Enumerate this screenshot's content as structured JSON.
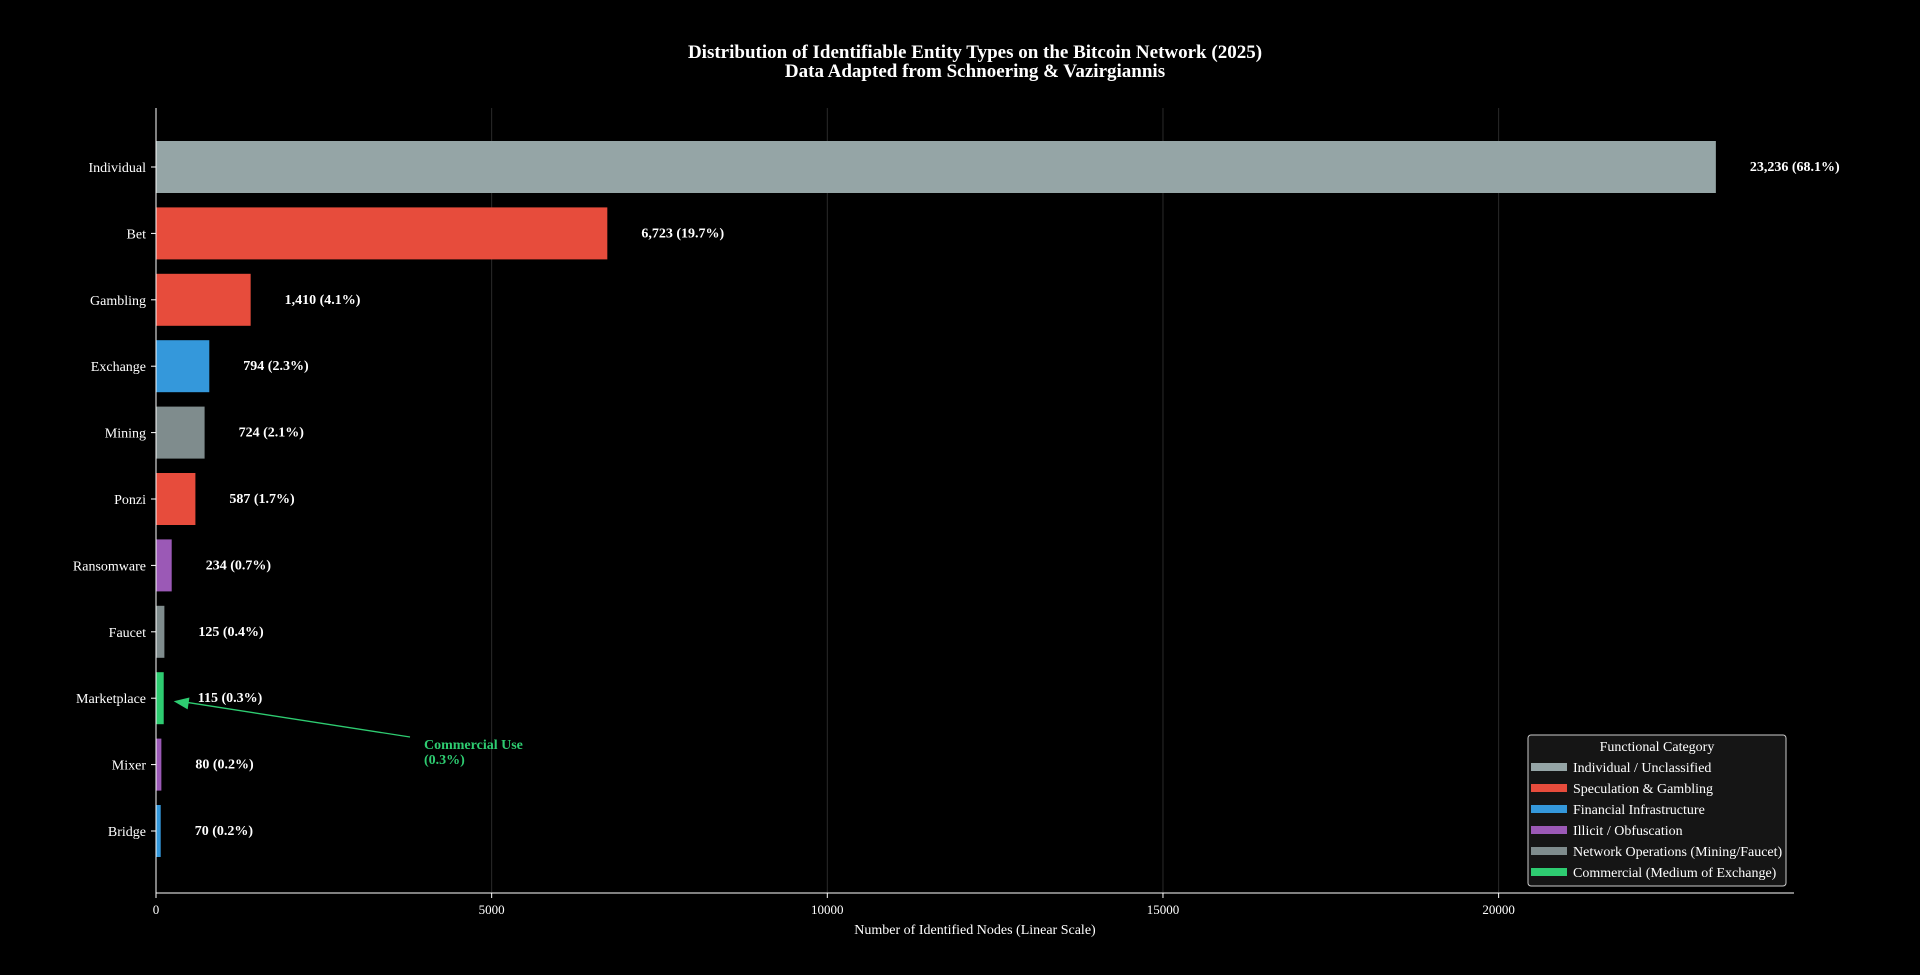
{
  "chart_data": {
    "type": "bar",
    "orientation": "horizontal",
    "title": "Distribution of Identifiable Entity Types on the Bitcoin Network (2025)",
    "subtitle": "Data Adapted from Schnoering & Vazirgiannis",
    "xlabel": "Number of Identified Nodes (Linear Scale)",
    "xlim": [
      0,
      24400
    ],
    "xticks": [
      0,
      5000,
      10000,
      15000,
      20000
    ],
    "grid": true,
    "categories": [
      "Individual",
      "Bet",
      "Gambling",
      "Exchange",
      "Mining",
      "Ponzi",
      "Ransomware",
      "Faucet",
      "Marketplace",
      "Mixer",
      "Bridge"
    ],
    "values": [
      23236,
      6723,
      1410,
      794,
      724,
      587,
      234,
      125,
      115,
      80,
      70
    ],
    "value_labels": [
      "23,236 (68.1%)",
      "6,723 (19.7%)",
      "1,410 (4.1%)",
      "794 (2.3%)",
      "724 (2.1%)",
      "587 (1.7%)",
      "234 (0.7%)",
      "125 (0.4%)",
      "115 (0.3%)",
      "80 (0.2%)",
      "70 (0.2%)"
    ],
    "bar_groups": [
      "individual",
      "speculation",
      "speculation",
      "financial",
      "network",
      "speculation",
      "illicit",
      "network",
      "commercial",
      "illicit",
      "financial"
    ],
    "annotation": {
      "target_category": "Marketplace",
      "lines": [
        "Commercial Use",
        "(0.3%)"
      ],
      "color": "#2ecc71"
    },
    "legend": {
      "title": "Functional Category",
      "placement": "lower-right",
      "items": [
        {
          "key": "individual",
          "label": "Individual / Unclassified",
          "color": "#95a5a6"
        },
        {
          "key": "speculation",
          "label": "Speculation & Gambling",
          "color": "#e74c3c"
        },
        {
          "key": "financial",
          "label": "Financial Infrastructure",
          "color": "#3498db"
        },
        {
          "key": "illicit",
          "label": "Illicit / Obfuscation",
          "color": "#9b59b6"
        },
        {
          "key": "network",
          "label": "Network Operations (Mining/Faucet)",
          "color": "#7f8c8d"
        },
        {
          "key": "commercial",
          "label": "Commercial (Medium of Exchange)",
          "color": "#2ecc71"
        }
      ]
    }
  }
}
